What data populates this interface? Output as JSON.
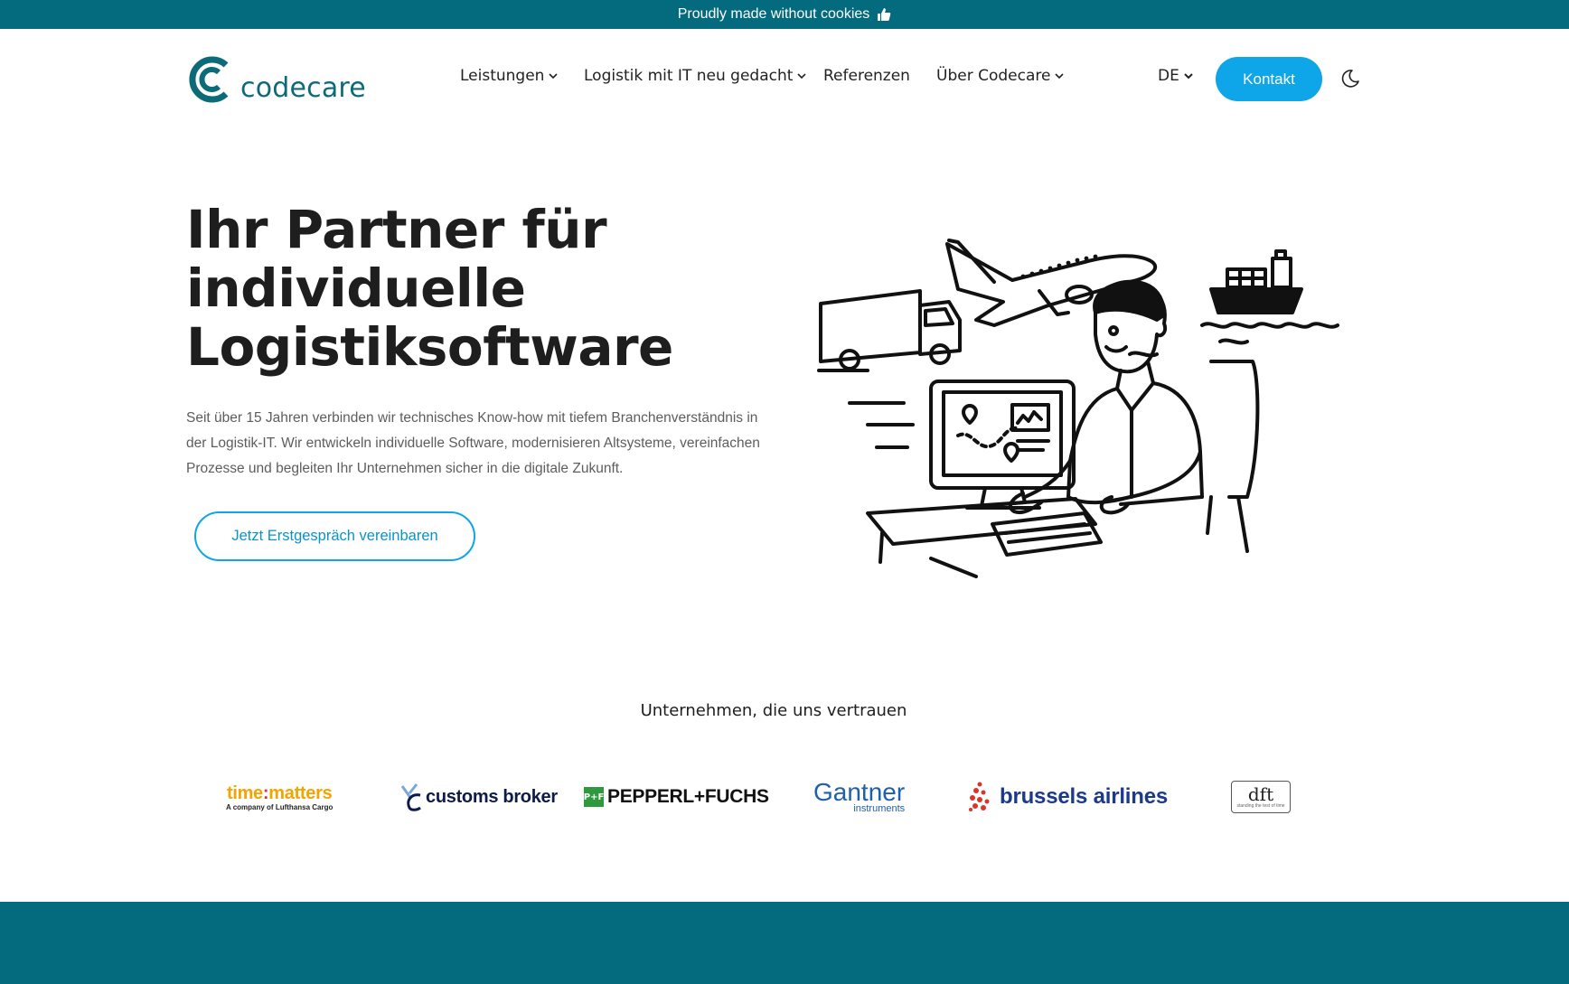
{
  "banner": {
    "text": "Proudly made without cookies",
    "icon": "thumbs-up-icon"
  },
  "brand": {
    "name": "codecare",
    "color": "#0d6b79"
  },
  "nav": {
    "items": [
      {
        "label": "Leistungen",
        "has_dropdown": true
      },
      {
        "label": "Logistik mit IT neu gedacht",
        "has_dropdown": true
      },
      {
        "label": "Referenzen",
        "has_dropdown": false
      },
      {
        "label": "Über Codecare",
        "has_dropdown": true
      }
    ],
    "language": "DE",
    "contact_button": "Kontakt",
    "theme_toggle_icon": "moon-icon"
  },
  "hero": {
    "title_lines": [
      "Ihr Partner für",
      "individuelle",
      "Logistiksoftware"
    ],
    "description": "Seit über 15 Jahren verbinden wir technisches Know-how mit tiefem Branchenverständnis in der Logistik-IT. Wir entwickeln individuelle Software, modernisieren Altsysteme, vereinfachen Prozesse und begleiten Ihr Unternehmen sicher in die digitale Zukunft.",
    "cta_label": "Jetzt Erstgespräch vereinbaren"
  },
  "trust": {
    "title": "Unternehmen, die uns vertrauen",
    "logos": {
      "time_matters": {
        "name_left": "time",
        "name_colon": ":",
        "name_right": "matters",
        "sub": "A company of Lufthansa Cargo"
      },
      "customs_broker": {
        "name": "customs broker"
      },
      "pepperl_fuchs": {
        "mark": "P+F",
        "name": "PEPPERL+FUCHS"
      },
      "gantner": {
        "name": "Gantner",
        "sub": "instruments"
      },
      "brussels_airlines": {
        "name": "brussels airlines"
      },
      "dft": {
        "name": "dft",
        "sub": "standing the test of time"
      }
    }
  },
  "colors": {
    "teal": "#046b7e",
    "accent": "#0ea5e9",
    "text": "#1e1e1e",
    "muted": "#5d5d5d"
  }
}
